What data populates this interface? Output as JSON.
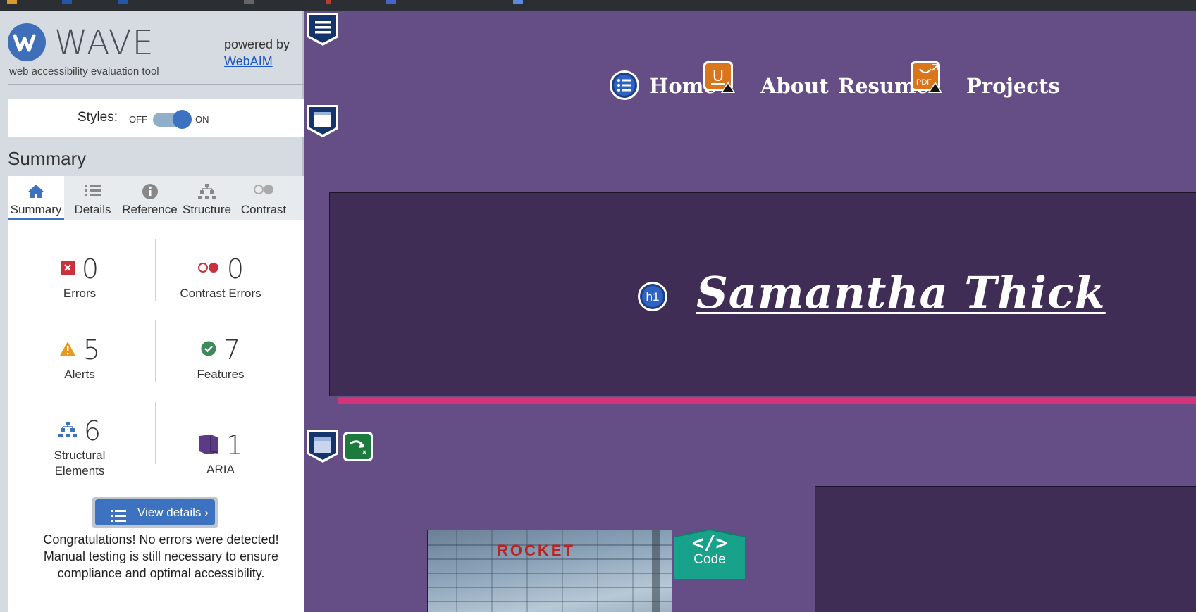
{
  "wave": {
    "title": "WAVE",
    "subtitle": "web accessibility evaluation tool",
    "powered_by": "powered by",
    "webaim_link": "WebAIM",
    "styles": {
      "label": "Styles:",
      "off": "OFF",
      "on": "ON",
      "state": "on"
    },
    "section_heading": "Summary",
    "tabs": [
      {
        "label": "Summary",
        "icon": "home-icon",
        "active": true
      },
      {
        "label": "Details",
        "icon": "list-icon",
        "active": false
      },
      {
        "label": "Reference",
        "icon": "info-icon",
        "active": false
      },
      {
        "label": "Structure",
        "icon": "structure-icon",
        "active": false
      },
      {
        "label": "Contrast",
        "icon": "contrast-icon",
        "active": false
      }
    ],
    "stats": {
      "errors": {
        "count": "0",
        "label": "Errors",
        "color": "#c9323a"
      },
      "contrast_errors": {
        "count": "0",
        "label": "Contrast Errors",
        "color": "#c9323a"
      },
      "alerts": {
        "count": "5",
        "label": "Alerts",
        "color": "#e89a1c"
      },
      "features": {
        "count": "7",
        "label": "Features",
        "color": "#3e8a5c"
      },
      "structural": {
        "count": "6",
        "label_line1": "Structural",
        "label_line2": "Elements",
        "color": "#3d72c0"
      },
      "aria": {
        "count": "1",
        "label": "ARIA",
        "color": "#5b3a86"
      }
    },
    "view_details": "View details ›",
    "congrats": {
      "line1": "Congratulations! No errors were detected!",
      "line2": "Manual testing is still necessary to ensure",
      "line3": "compliance and optimal accessibility."
    }
  },
  "site": {
    "nav": [
      "Home",
      "About",
      "Resume",
      "Projects"
    ],
    "hero_title": "Samantha Thick",
    "h1_badge": "h1",
    "project_image_text": "ROCKET",
    "code_badge": {
      "symbol": "</>",
      "label": "Code"
    }
  },
  "colors": {
    "page_bg": "#654d85",
    "hero_bg": "#3f2d56",
    "accent_bar": "#d4337a",
    "wave_blue": "#3d72c0",
    "code_badge": "#1aa08a"
  }
}
